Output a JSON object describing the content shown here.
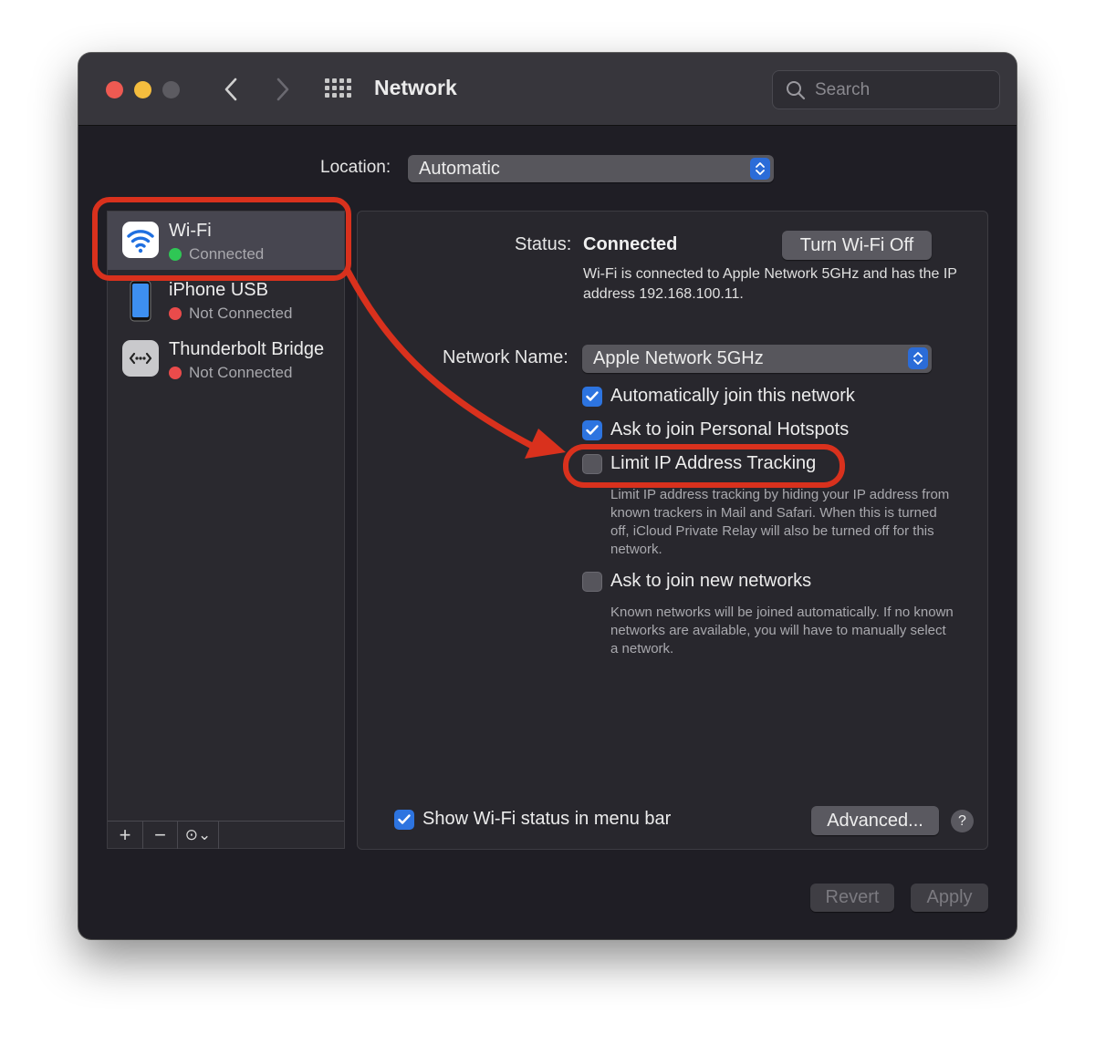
{
  "window": {
    "title": "Network",
    "search_placeholder": "Search"
  },
  "location": {
    "label": "Location:",
    "value": "Automatic"
  },
  "sidebar": {
    "items": [
      {
        "name": "Wi-Fi",
        "status": "Connected",
        "status_color": "#2fc755",
        "icon": "wifi-icon",
        "selected": true
      },
      {
        "name": "iPhone USB",
        "status": "Not Connected",
        "status_color": "#ea4b4b",
        "icon": "iphone-icon",
        "selected": false
      },
      {
        "name": "Thunderbolt Bridge",
        "status": "Not Connected",
        "status_color": "#ea4b4b",
        "icon": "thunderbolt-bridge-icon",
        "selected": false
      }
    ],
    "add_label": "+",
    "remove_label": "−",
    "action_label": "⊙⌄"
  },
  "detail": {
    "status_label": "Status:",
    "status_value": "Connected",
    "turn_off_label": "Turn Wi-Fi Off",
    "status_description": "Wi-Fi is connected to Apple Network 5GHz and has the IP address 192.168.100.11.",
    "network_name_label": "Network Name:",
    "network_name_value": "Apple Network 5GHz",
    "options": [
      {
        "label": "Automatically join this network",
        "checked": true
      },
      {
        "label": "Ask to join Personal Hotspots",
        "checked": true
      },
      {
        "label": "Limit IP Address Tracking",
        "checked": false
      },
      {
        "label": "Ask to join new networks",
        "checked": false
      }
    ],
    "limit_ip_help": "Limit IP address tracking by hiding your IP address from known trackers in Mail and Safari. When this is turned off, iCloud Private Relay will also be turned off for this network.",
    "new_networks_help": "Known networks will be joined automatically. If no known networks are available, you will have to manually select a network.",
    "show_status_label": "Show Wi-Fi status in menu bar",
    "show_status_checked": true,
    "advanced_label": "Advanced...",
    "help_label": "?"
  },
  "footer": {
    "revert_label": "Revert",
    "apply_label": "Apply"
  },
  "colors": {
    "accent": "#2d74e0",
    "annotation": "#d9311d"
  }
}
